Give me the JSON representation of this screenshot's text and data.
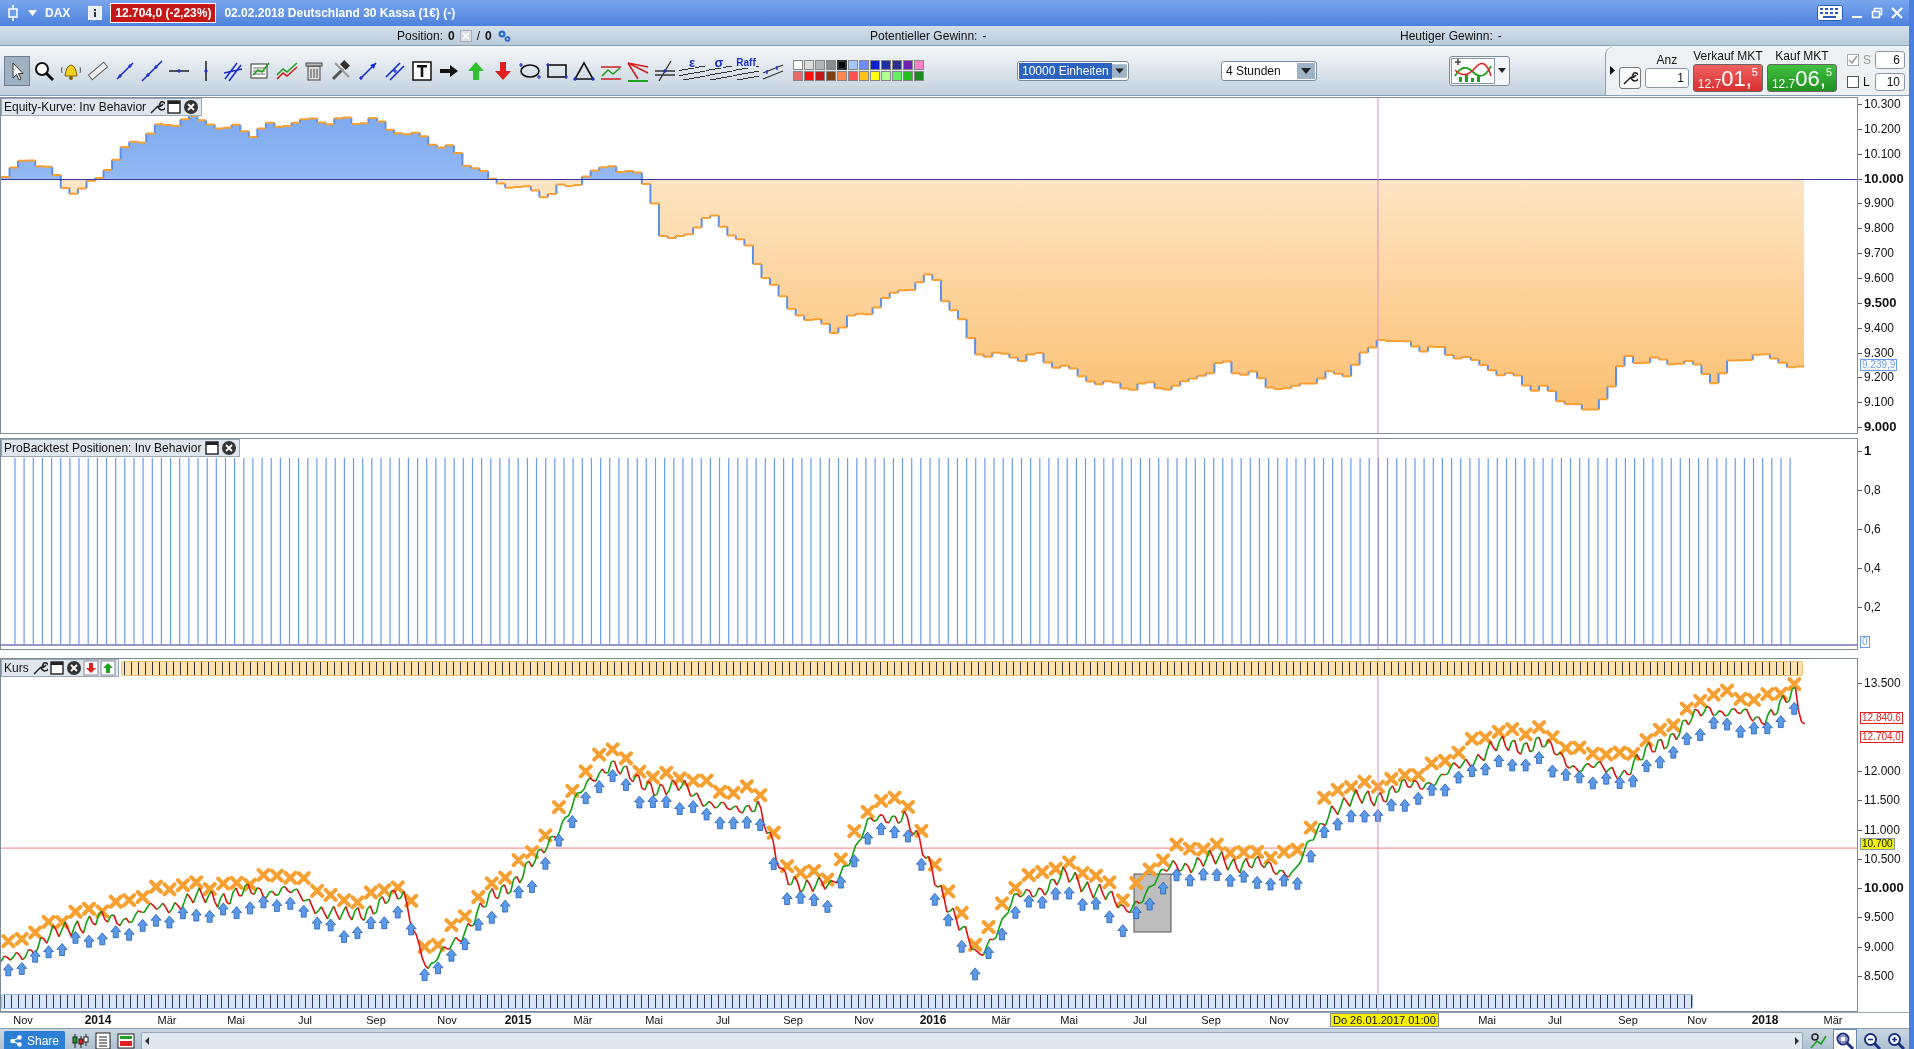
{
  "title_bar": {
    "symbol": "DAX",
    "price_badge": "12.704,0 (-2,23%)",
    "description": "02.02.2018 Deutschland 30 Kassa (1€) (-)"
  },
  "info_bar": {
    "position_label": "Position:",
    "position_value": "0",
    "separator": "/",
    "position_total": "0",
    "potential_label": "Potentieller Gewinn:",
    "potential_value": "-",
    "today_label": "Heutiger Gewinn:",
    "today_value": "-"
  },
  "toolbar": {
    "tool_glyphs": [
      "ε",
      "σ",
      "Raff"
    ],
    "palette": [
      {
        "color": "#ffffff",
        "selected": false
      },
      {
        "color": "#dcdcdc",
        "selected": false
      },
      {
        "color": "#b4b4b4",
        "selected": false
      },
      {
        "color": "#8c8c8c",
        "selected": false
      },
      {
        "color": "#000000",
        "selected": true
      },
      {
        "color": "#a8c4ff",
        "selected": false
      },
      {
        "color": "#6e8cff",
        "selected": false
      },
      {
        "color": "#1020d0",
        "selected": false
      },
      {
        "color": "#2030a0",
        "selected": false
      },
      {
        "color": "#283088",
        "selected": false
      },
      {
        "color": "#7020b0",
        "selected": false
      },
      {
        "color": "#ff80c8",
        "selected": false
      },
      {
        "color": "#e86a6a",
        "selected": false
      },
      {
        "color": "#ff1010",
        "selected": false
      },
      {
        "color": "#c01818",
        "selected": false
      },
      {
        "color": "#7a4010",
        "selected": false
      },
      {
        "color": "#ff8850",
        "selected": false
      },
      {
        "color": "#ff5050",
        "selected": false
      },
      {
        "color": "#ffc020",
        "selected": false
      },
      {
        "color": "#ffff10",
        "selected": false
      },
      {
        "color": "#b0ff90",
        "selected": false
      },
      {
        "color": "#60f060",
        "selected": false
      },
      {
        "color": "#20c020",
        "selected": false
      },
      {
        "color": "#208820",
        "selected": false
      }
    ],
    "quantity_select": {
      "value": "10000 Einheiten",
      "selected": true
    },
    "timeframe_select": {
      "value": "4 Stunden",
      "selected": false
    }
  },
  "order_panel": {
    "quantity_label": "Anz",
    "quantity": "1",
    "sell": {
      "label": "Verkauf MKT",
      "price_prefix": "12.7",
      "price_main": "01,",
      "price_fraction": "5"
    },
    "buy": {
      "label": "Kauf MKT",
      "price_prefix": "12.7",
      "price_main": "06,",
      "price_fraction": "5"
    },
    "stop": {
      "label": "S",
      "checked": true,
      "disabled": true,
      "value": "6"
    },
    "limit": {
      "label": "L",
      "checked": false,
      "disabled": false,
      "value": "10"
    }
  },
  "panels": [
    {
      "kind": "equity",
      "title": "Equity-Kurve: Inv Behavior",
      "axis_ticks": [
        {
          "label": "10.300",
          "bold": false
        },
        {
          "label": "10.200",
          "bold": false
        },
        {
          "label": "10.100",
          "bold": false
        },
        {
          "label": "10.000",
          "bold": true
        },
        {
          "label": "9.900",
          "bold": false
        },
        {
          "label": "9.800",
          "bold": false
        },
        {
          "label": "9.700",
          "bold": false
        },
        {
          "label": "9.600",
          "bold": false
        },
        {
          "label": "9.500",
          "bold": true
        },
        {
          "label": "9.400",
          "bold": false
        },
        {
          "label": "9.300",
          "bold": false
        },
        {
          "label": "9.200",
          "bold": false
        },
        {
          "label": "9.100",
          "bold": false
        },
        {
          "label": "9.000",
          "bold": true
        }
      ],
      "value_tags": [
        {
          "label": "9.239,9",
          "color": "#6a9cf0"
        }
      ]
    },
    {
      "kind": "positions",
      "title": "ProBacktest Positionen: Inv Behavior",
      "axis_ticks": [
        {
          "label": "1",
          "bold": true
        },
        {
          "label": "0,8",
          "bold": false
        },
        {
          "label": "0,6",
          "bold": false
        },
        {
          "label": "0,4",
          "bold": false
        },
        {
          "label": "0,2",
          "bold": false
        }
      ],
      "value_tags": [
        {
          "label": "0",
          "color": "#6a9cf0"
        }
      ]
    },
    {
      "kind": "price",
      "title": "Kurs",
      "axis_ticks": [
        {
          "label": "13.500",
          "bold": false
        },
        {
          "label": "12.000",
          "bold": false
        },
        {
          "label": "11.500",
          "bold": false
        },
        {
          "label": "11.000",
          "bold": false
        },
        {
          "label": "10.500",
          "bold": false
        },
        {
          "label": "10.000",
          "bold": true
        },
        {
          "label": "9.500",
          "bold": false
        },
        {
          "label": "9.000",
          "bold": false
        },
        {
          "label": "8.500",
          "bold": false
        }
      ],
      "value_tags": [
        {
          "label": "12.840,6",
          "color": "#e02020"
        },
        {
          "label": "12.704,0",
          "color": "#e02020"
        },
        {
          "label": "10.700",
          "color": "#f0f000"
        }
      ]
    }
  ],
  "time_axis": {
    "labels": [
      {
        "label": "Nov",
        "bold": false
      },
      {
        "label": "2014",
        "bold": true
      },
      {
        "label": "Mär",
        "bold": false
      },
      {
        "label": "Mai",
        "bold": false
      },
      {
        "label": "Jul",
        "bold": false
      },
      {
        "label": "Sep",
        "bold": false
      },
      {
        "label": "Nov",
        "bold": false
      },
      {
        "label": "2015",
        "bold": true
      },
      {
        "label": "Mär",
        "bold": false
      },
      {
        "label": "Mai",
        "bold": false
      },
      {
        "label": "Jul",
        "bold": false
      },
      {
        "label": "Sep",
        "bold": false
      },
      {
        "label": "Nov",
        "bold": false
      },
      {
        "label": "2016",
        "bold": true
      },
      {
        "label": "Mär",
        "bold": false
      },
      {
        "label": "Mai",
        "bold": false
      },
      {
        "label": "Jul",
        "bold": false
      },
      {
        "label": "Sep",
        "bold": false
      },
      {
        "label": "Nov",
        "bold": false
      },
      {
        "label": "Mai",
        "bold": false
      },
      {
        "label": "Jul",
        "bold": false
      },
      {
        "label": "Sep",
        "bold": false
      },
      {
        "label": "Nov",
        "bold": false
      },
      {
        "label": "2018",
        "bold": true
      },
      {
        "label": "Mär",
        "bold": false
      }
    ],
    "cursor_tag": "Do 26.01.2017 01:00"
  },
  "bottom_bar": {
    "share_button": "Share"
  }
}
